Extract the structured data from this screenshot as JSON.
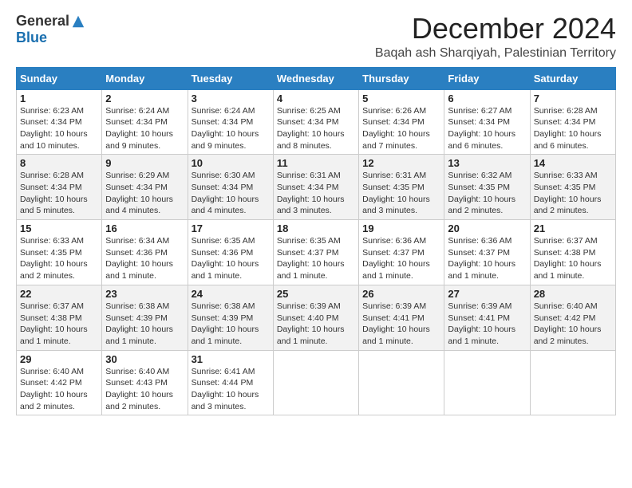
{
  "header": {
    "logo_general": "General",
    "logo_blue": "Blue",
    "month_title": "December 2024",
    "location": "Baqah ash Sharqiyah, Palestinian Territory"
  },
  "days_of_week": [
    "Sunday",
    "Monday",
    "Tuesday",
    "Wednesday",
    "Thursday",
    "Friday",
    "Saturday"
  ],
  "weeks": [
    [
      {
        "day": "1",
        "sunrise": "6:23 AM",
        "sunset": "4:34 PM",
        "daylight": "10 hours and 10 minutes."
      },
      {
        "day": "2",
        "sunrise": "6:24 AM",
        "sunset": "4:34 PM",
        "daylight": "10 hours and 9 minutes."
      },
      {
        "day": "3",
        "sunrise": "6:24 AM",
        "sunset": "4:34 PM",
        "daylight": "10 hours and 9 minutes."
      },
      {
        "day": "4",
        "sunrise": "6:25 AM",
        "sunset": "4:34 PM",
        "daylight": "10 hours and 8 minutes."
      },
      {
        "day": "5",
        "sunrise": "6:26 AM",
        "sunset": "4:34 PM",
        "daylight": "10 hours and 7 minutes."
      },
      {
        "day": "6",
        "sunrise": "6:27 AM",
        "sunset": "4:34 PM",
        "daylight": "10 hours and 6 minutes."
      },
      {
        "day": "7",
        "sunrise": "6:28 AM",
        "sunset": "4:34 PM",
        "daylight": "10 hours and 6 minutes."
      }
    ],
    [
      {
        "day": "8",
        "sunrise": "6:28 AM",
        "sunset": "4:34 PM",
        "daylight": "10 hours and 5 minutes."
      },
      {
        "day": "9",
        "sunrise": "6:29 AM",
        "sunset": "4:34 PM",
        "daylight": "10 hours and 4 minutes."
      },
      {
        "day": "10",
        "sunrise": "6:30 AM",
        "sunset": "4:34 PM",
        "daylight": "10 hours and 4 minutes."
      },
      {
        "day": "11",
        "sunrise": "6:31 AM",
        "sunset": "4:34 PM",
        "daylight": "10 hours and 3 minutes."
      },
      {
        "day": "12",
        "sunrise": "6:31 AM",
        "sunset": "4:35 PM",
        "daylight": "10 hours and 3 minutes."
      },
      {
        "day": "13",
        "sunrise": "6:32 AM",
        "sunset": "4:35 PM",
        "daylight": "10 hours and 2 minutes."
      },
      {
        "day": "14",
        "sunrise": "6:33 AM",
        "sunset": "4:35 PM",
        "daylight": "10 hours and 2 minutes."
      }
    ],
    [
      {
        "day": "15",
        "sunrise": "6:33 AM",
        "sunset": "4:35 PM",
        "daylight": "10 hours and 2 minutes."
      },
      {
        "day": "16",
        "sunrise": "6:34 AM",
        "sunset": "4:36 PM",
        "daylight": "10 hours and 1 minute."
      },
      {
        "day": "17",
        "sunrise": "6:35 AM",
        "sunset": "4:36 PM",
        "daylight": "10 hours and 1 minute."
      },
      {
        "day": "18",
        "sunrise": "6:35 AM",
        "sunset": "4:37 PM",
        "daylight": "10 hours and 1 minute."
      },
      {
        "day": "19",
        "sunrise": "6:36 AM",
        "sunset": "4:37 PM",
        "daylight": "10 hours and 1 minute."
      },
      {
        "day": "20",
        "sunrise": "6:36 AM",
        "sunset": "4:37 PM",
        "daylight": "10 hours and 1 minute."
      },
      {
        "day": "21",
        "sunrise": "6:37 AM",
        "sunset": "4:38 PM",
        "daylight": "10 hours and 1 minute."
      }
    ],
    [
      {
        "day": "22",
        "sunrise": "6:37 AM",
        "sunset": "4:38 PM",
        "daylight": "10 hours and 1 minute."
      },
      {
        "day": "23",
        "sunrise": "6:38 AM",
        "sunset": "4:39 PM",
        "daylight": "10 hours and 1 minute."
      },
      {
        "day": "24",
        "sunrise": "6:38 AM",
        "sunset": "4:39 PM",
        "daylight": "10 hours and 1 minute."
      },
      {
        "day": "25",
        "sunrise": "6:39 AM",
        "sunset": "4:40 PM",
        "daylight": "10 hours and 1 minute."
      },
      {
        "day": "26",
        "sunrise": "6:39 AM",
        "sunset": "4:41 PM",
        "daylight": "10 hours and 1 minute."
      },
      {
        "day": "27",
        "sunrise": "6:39 AM",
        "sunset": "4:41 PM",
        "daylight": "10 hours and 1 minute."
      },
      {
        "day": "28",
        "sunrise": "6:40 AM",
        "sunset": "4:42 PM",
        "daylight": "10 hours and 2 minutes."
      }
    ],
    [
      {
        "day": "29",
        "sunrise": "6:40 AM",
        "sunset": "4:42 PM",
        "daylight": "10 hours and 2 minutes."
      },
      {
        "day": "30",
        "sunrise": "6:40 AM",
        "sunset": "4:43 PM",
        "daylight": "10 hours and 2 minutes."
      },
      {
        "day": "31",
        "sunrise": "6:41 AM",
        "sunset": "4:44 PM",
        "daylight": "10 hours and 3 minutes."
      },
      null,
      null,
      null,
      null
    ]
  ],
  "labels": {
    "sunrise": "Sunrise:",
    "sunset": "Sunset:",
    "daylight": "Daylight:"
  }
}
